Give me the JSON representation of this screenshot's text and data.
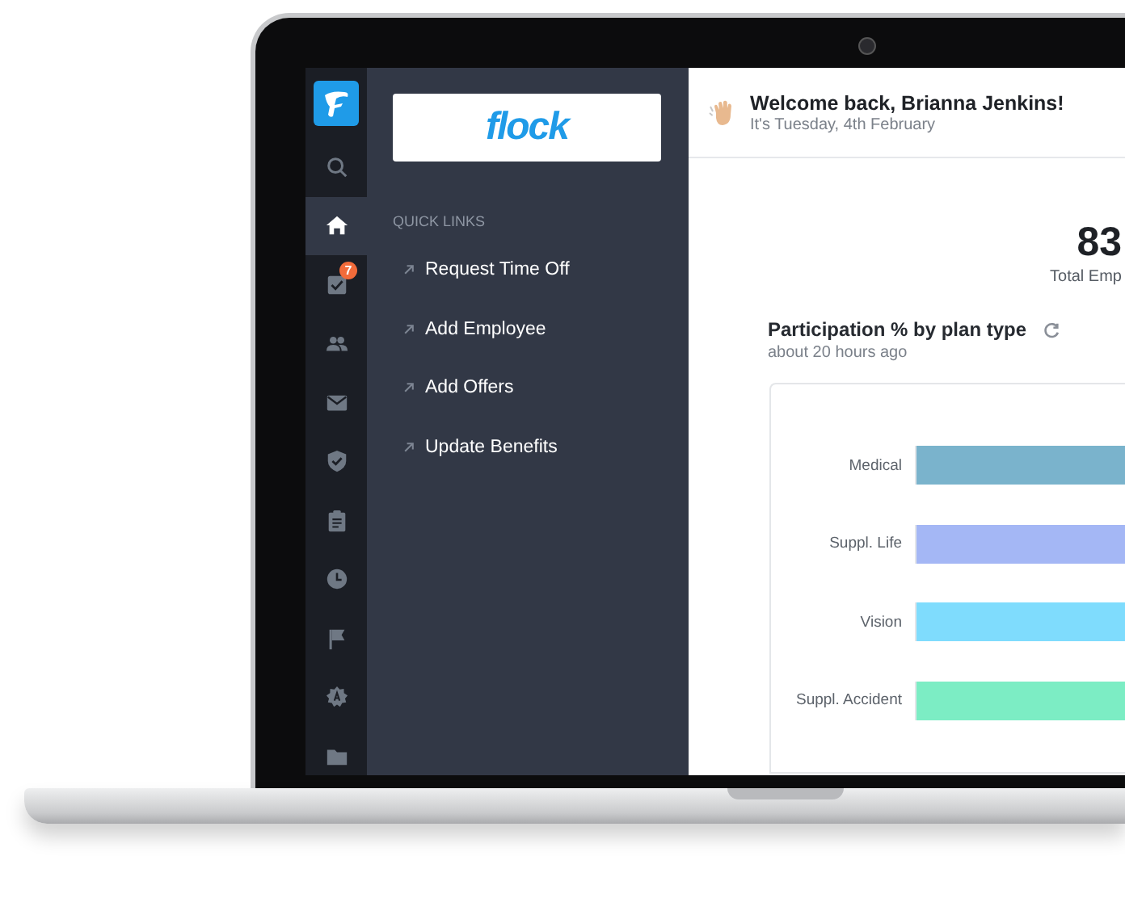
{
  "rail": {
    "badge": "7",
    "items": [
      {
        "kind": "search",
        "selected": false
      },
      {
        "kind": "home",
        "selected": true
      },
      {
        "kind": "tasks",
        "selected": false,
        "badge": true
      },
      {
        "kind": "people",
        "selected": false
      },
      {
        "kind": "mail",
        "selected": false
      },
      {
        "kind": "shield",
        "selected": false
      },
      {
        "kind": "clipboard",
        "selected": false
      },
      {
        "kind": "clock",
        "selected": false
      },
      {
        "kind": "flag",
        "selected": false
      },
      {
        "kind": "cog",
        "selected": false
      },
      {
        "kind": "folder",
        "selected": false
      }
    ]
  },
  "panel": {
    "logo": "flock",
    "heading": "QUICK LINKS",
    "links": [
      "Request Time Off",
      "Add Employee",
      "Add Offers",
      "Update Benefits"
    ]
  },
  "header": {
    "title": "Welcome back, Brianna Jenkins!",
    "subtitle": "It's Tuesday, 4th February"
  },
  "stat": {
    "value": "83",
    "label": "Total Emp"
  },
  "chart": {
    "title": "Participation % by plan type",
    "updated": "about 20 hours ago",
    "bars": [
      {
        "label": "Medical",
        "color": "#7ab3cc"
      },
      {
        "label": "Suppl. Life",
        "color": "#a4b7f5"
      },
      {
        "label": "Vision",
        "color": "#7fdcfd"
      },
      {
        "label": "Suppl. Accident",
        "color": "#7cedc4"
      }
    ]
  }
}
